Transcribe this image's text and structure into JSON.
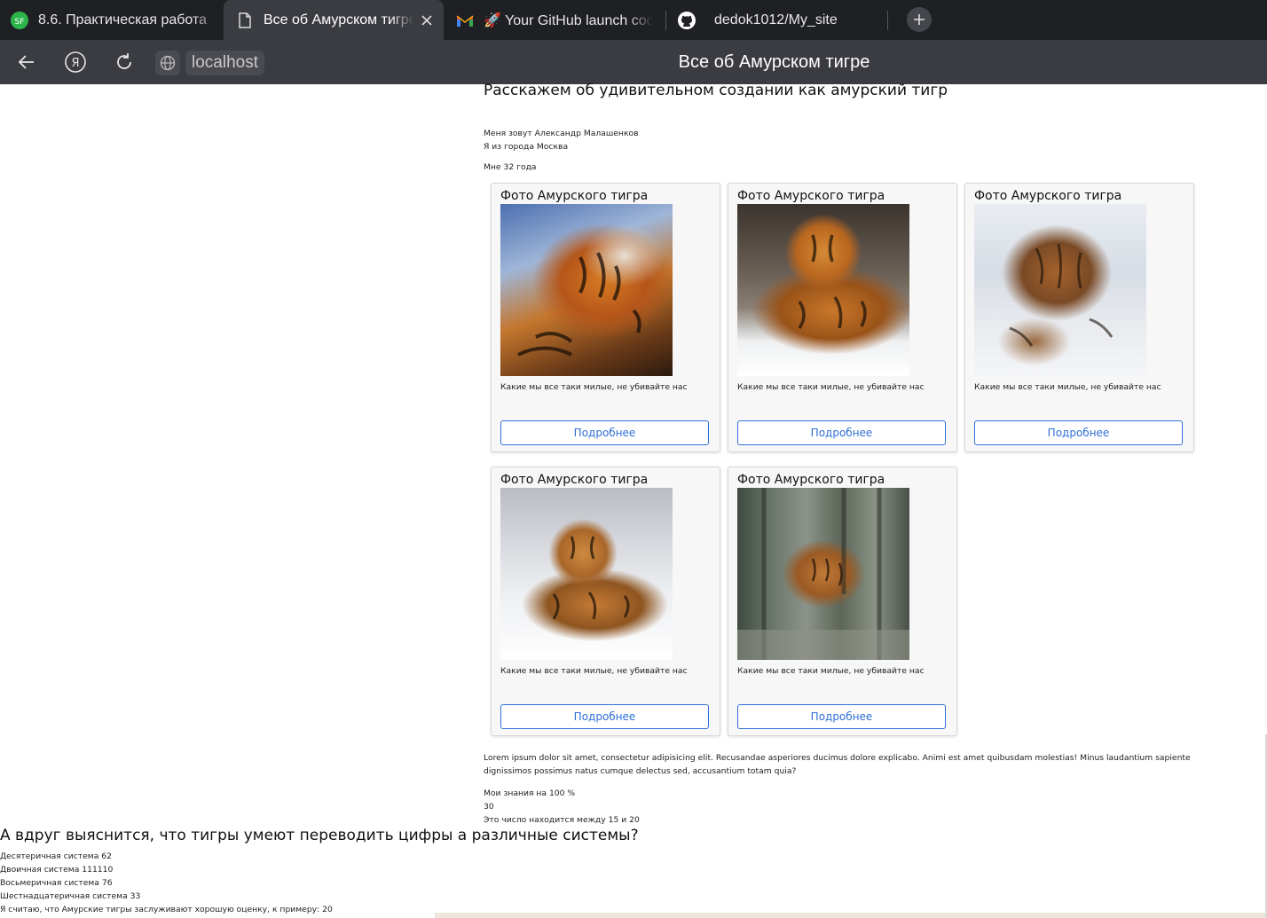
{
  "browser": {
    "tabs": [
      {
        "label": "8.6. Практическая работа",
        "icon": "sf-icon"
      },
      {
        "label": "Все об Амурском тигре",
        "icon": "page-icon",
        "active": true
      },
      {
        "label": "🚀 Your GitHub launch code",
        "icon": "gmail-icon"
      },
      {
        "label": "dedok1012/My_site",
        "icon": "github-icon"
      }
    ],
    "address": "localhost",
    "page_title": "Все об Амурском тигре"
  },
  "page": {
    "intro_heading": "Расскажем об удивительном создании как амурский тигр",
    "name_line": "Меня зовут Александр Малашенков",
    "city_line": "Я из города Москва",
    "age_line": "Мне 32 года",
    "cards": [
      {
        "title": "Фото Амурского тигра",
        "text": "Какие мы все таки милые, не убивайте нас",
        "button": "Подробнее"
      },
      {
        "title": "Фото Амурского тигра",
        "text": "Какие мы все таки милые, не убивайте нас",
        "button": "Подробнее"
      },
      {
        "title": "Фото Амурского тигра",
        "text": "Какие мы все таки милые, не убивайте нас",
        "button": "Подробнее"
      },
      {
        "title": "Фото Амурского тигра",
        "text": "Какие мы все таки милые, не убивайте нас",
        "button": "Подробнее"
      },
      {
        "title": "Фото Амурского тигра",
        "text": "Какие мы все таки милые, не убивайте нас",
        "button": "Подробнее"
      }
    ],
    "lorem": "Lorem ipsum dolor sit amet, consectetur adipisicing elit. Recusandae asperiores ducimus dolore explicabo. Animi est amet quibusdam molestias! Minus laudantium sapiente dignissimos possimus natus cumque delectus sed, accusantium totam quia?",
    "knowledge": "Мои знания на 100 %",
    "number": "30",
    "between": "Это число находится между 15 и 20",
    "bottom_heading": "А вдруг выяснится, что тигры умеют переводить цифры а различные системы?",
    "decimal": "Десятеричная система 62",
    "binary": "Двоичная система 111110",
    "octal": "Восьмеричная система 76",
    "hex": "Шестнадцатеричная система 33",
    "rating": "Я считаю, что Амурские тигры заслуживают хорошую оценку, к примеру: 20"
  }
}
